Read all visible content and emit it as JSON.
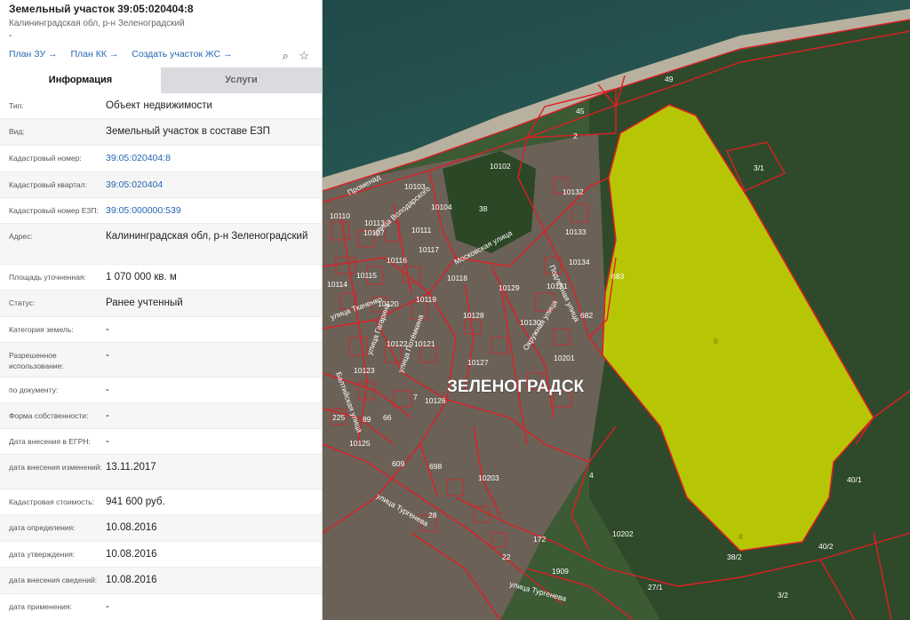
{
  "header": {
    "title": "Земельный участок 39:05:020404:8",
    "subtitle": "Калининградская обл, р-н Зеленоградский",
    "dash": "-"
  },
  "links": [
    "План ЗУ →",
    "План КК →",
    "Создать участок ЖС →"
  ],
  "tabs": {
    "info": "Информация",
    "services": "Услуги"
  },
  "rows": [
    {
      "label": "Тип:",
      "value": "Объект недвижимости",
      "h": 28
    },
    {
      "label": "Вид:",
      "value": "Земельный участок в составе ЕЗП",
      "h": 29
    },
    {
      "label": "Кадастровый номер:",
      "value": "39:05:020404:8",
      "link": true,
      "h": 29
    },
    {
      "label": "Кадастровый квартал:",
      "value": "39:05:020404",
      "link": true,
      "h": 28
    },
    {
      "label": "Кадастровый номер ЕЗП:",
      "value": "39:05:000000:539",
      "link": true,
      "h": 28
    },
    {
      "label": "Адрес:",
      "value": "Калининградская обл, р-н Зеленоградский",
      "h": 45
    },
    {
      "label": "Площадь уточненная:",
      "value": "1 070 000 кв. м",
      "h": 28
    },
    {
      "label": "Статус:",
      "value": "Ранее учтенный",
      "h": 29
    },
    {
      "label": "Категория земель:",
      "value": "-",
      "h": 28
    },
    {
      "label": "Разрешенное использование:",
      "value": "-",
      "h": 38
    },
    {
      "label": "по документу:",
      "value": "-",
      "h": 28
    },
    {
      "label": "Форма собственности:",
      "value": "-",
      "h": 28
    },
    {
      "label": "Дата внесения в ЕГРН:",
      "value": "-",
      "h": 28
    },
    {
      "label": "дата внесения изменений:",
      "value": "13.11.2017",
      "h": 38
    },
    {
      "label": "Кадастровая стоимость:",
      "value": "941 600 руб.",
      "h": 28
    },
    {
      "label": "дата определения:",
      "value": "10.08.2016",
      "h": 29
    },
    {
      "label": "дата утверждения:",
      "value": "10.08.2016",
      "h": 28
    },
    {
      "label": "дата внесения сведений:",
      "value": "10.08.2016",
      "h": 29
    },
    {
      "label": "дата применения:",
      "value": "-",
      "h": 31
    }
  ],
  "map": {
    "city": "ЗЕЛЕНОГРАДСК",
    "streets": [
      "Променад",
      "улица Володарского",
      "Московская улица",
      "Окружная улица",
      "Подлесная улица",
      "улица Тургенева",
      "улица Тургенева",
      "улица Ткаченко",
      "Балтийская улица",
      "улица Гагарина",
      "улица Потёмкина"
    ],
    "parcels": [
      "49",
      "45",
      "2",
      "3/1",
      "8",
      "8",
      "10102",
      "10103",
      "10104",
      "38",
      "10132",
      "10133",
      "10134",
      "10110",
      "10107",
      "10116",
      "10117",
      "10118",
      "10129",
      "10131",
      "683",
      "682",
      "10114",
      "10115",
      "10120",
      "10119",
      "10128",
      "10130",
      "10122",
      "10121",
      "10127",
      "10201",
      "10123",
      "10126",
      "10202",
      "10203",
      "4",
      "40/1",
      "40/2",
      "38/2",
      "27/1",
      "3/2",
      "172",
      "1909",
      "22",
      "28",
      "225",
      "89",
      "66",
      "609",
      "698",
      "10125",
      "10113",
      "10111",
      "7"
    ],
    "colors": {
      "highlight": "#c6d400",
      "boundary": "#e01e26"
    }
  }
}
